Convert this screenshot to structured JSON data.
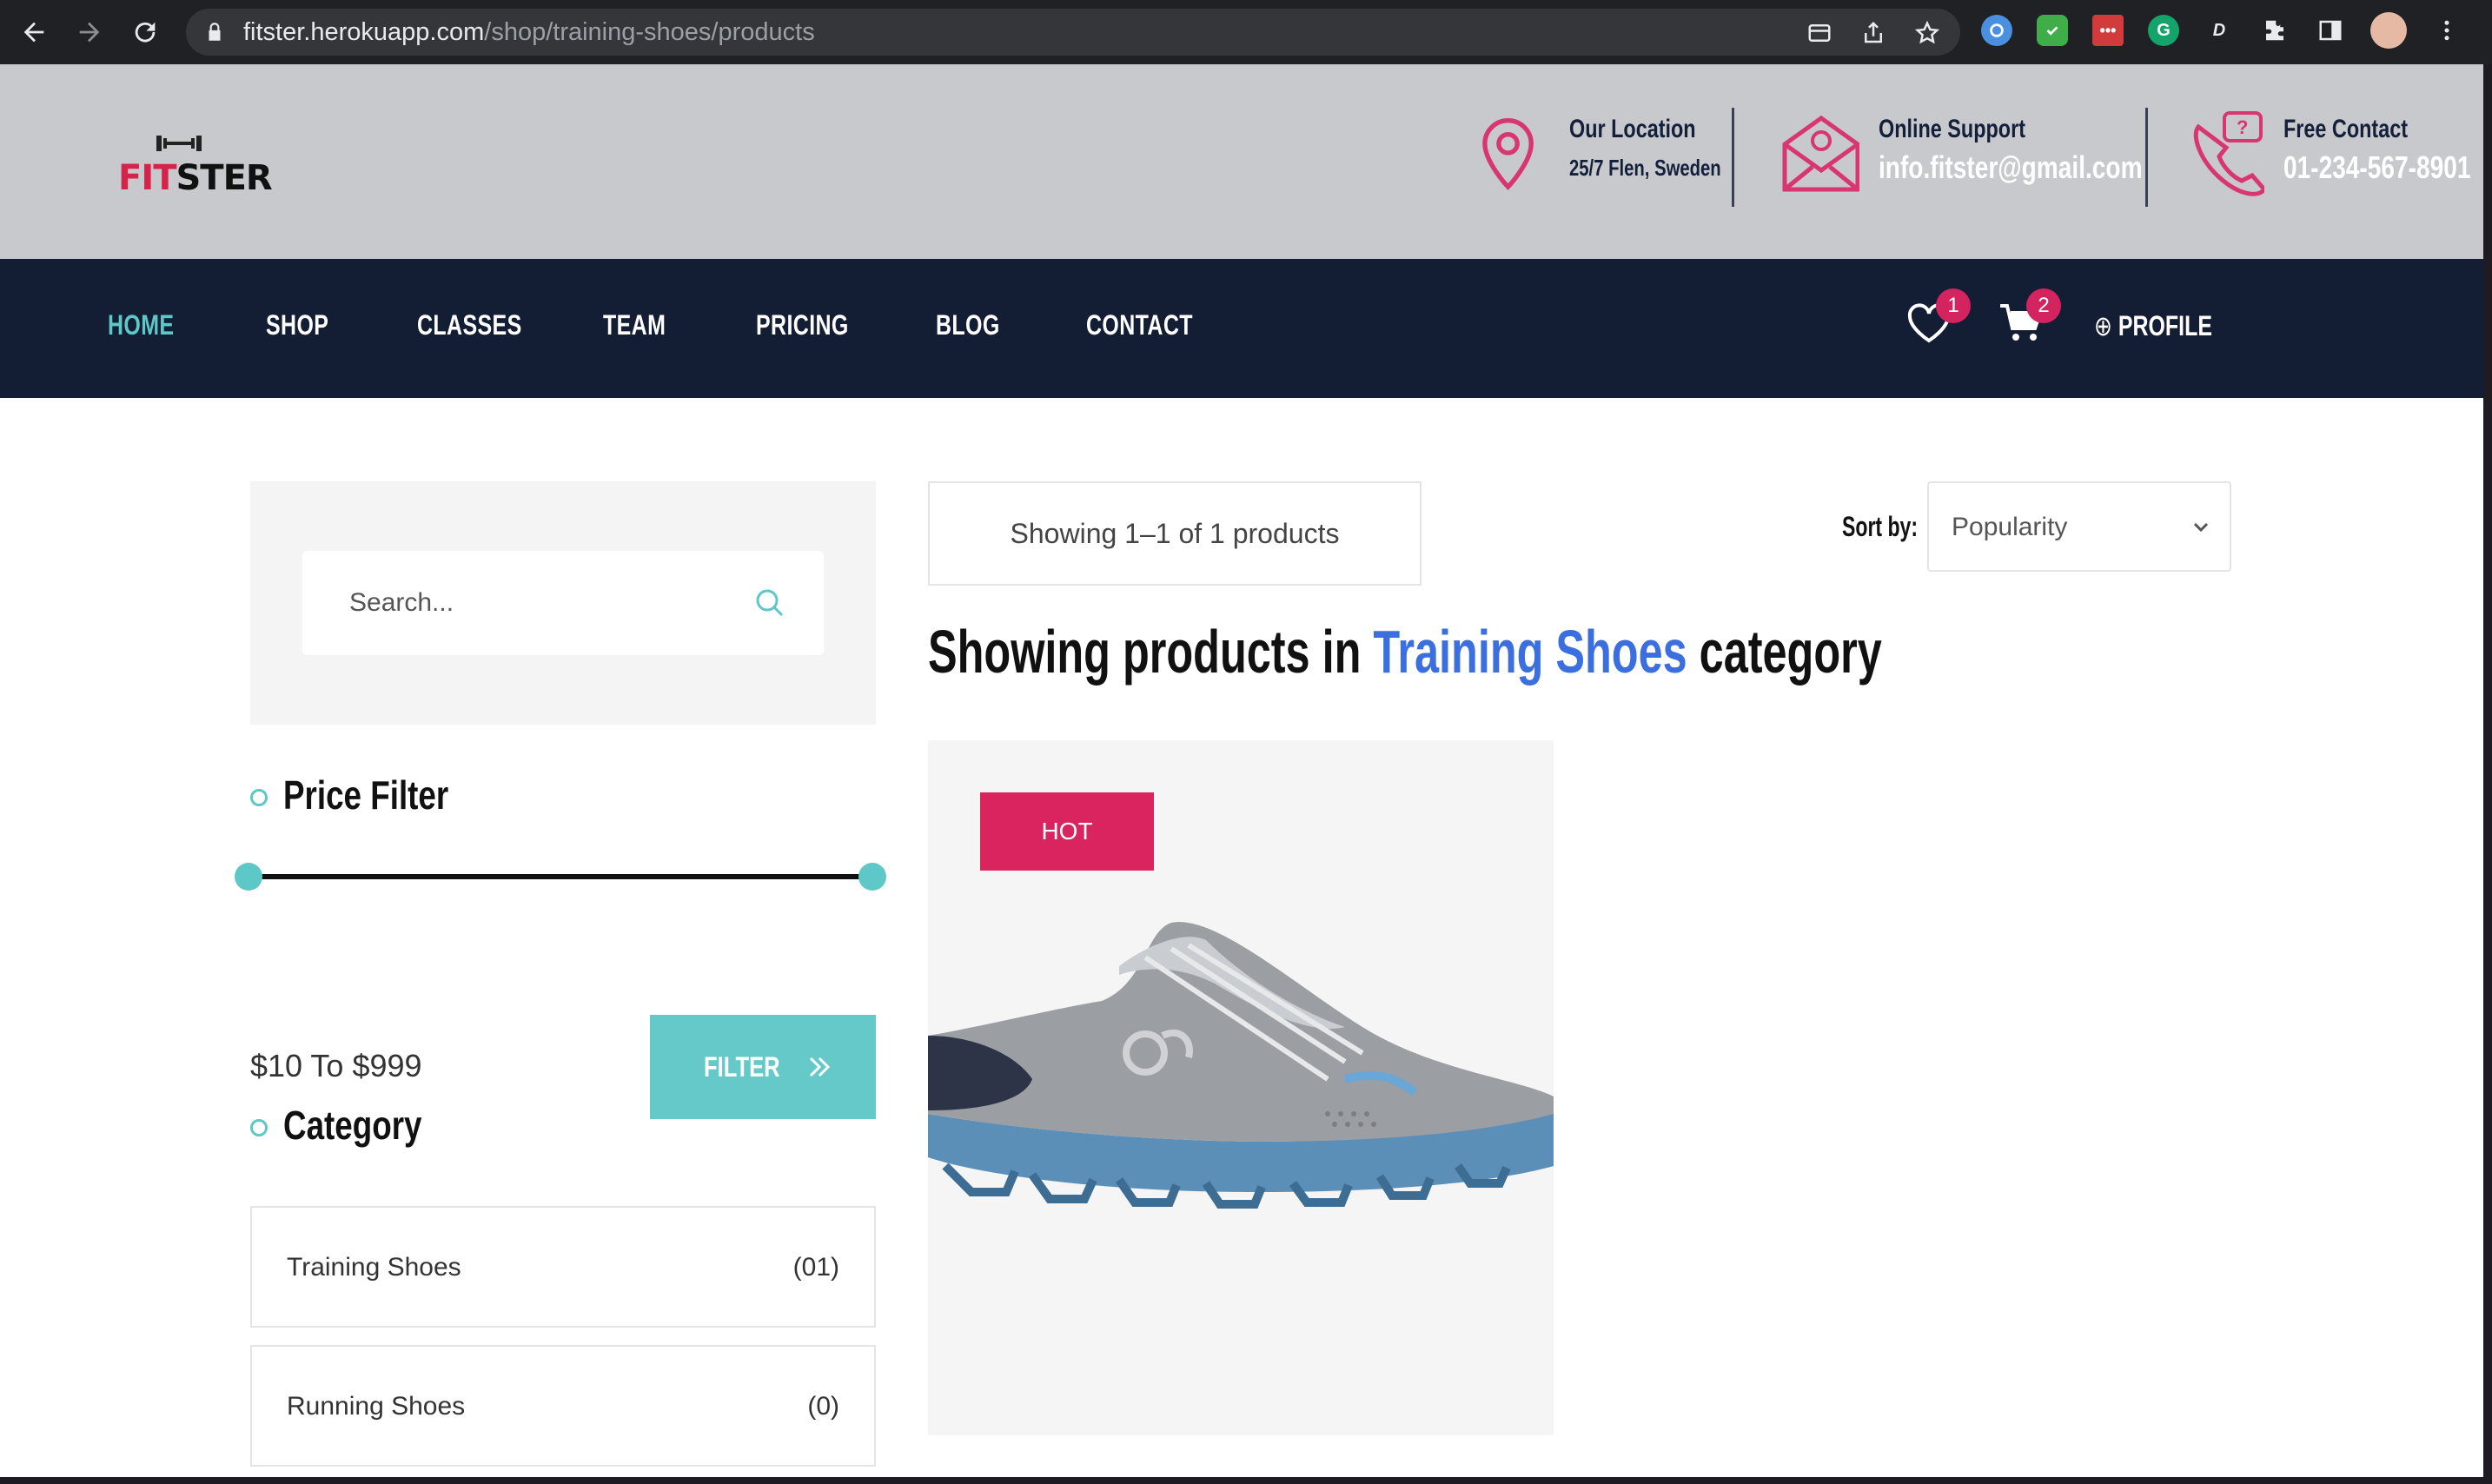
{
  "browser": {
    "url_host": "fitster.herokuapp.com",
    "url_path": "/shop/training-shoes/products"
  },
  "header": {
    "logo": {
      "prefix": "FIT",
      "suffix": "STER"
    },
    "location": {
      "title": "Our Location",
      "value": "25/7 Flen, Sweden",
      "icon": "map-pin-icon"
    },
    "support": {
      "title": "Online Support",
      "value": "info.fitster@gmail.com",
      "icon": "envelope-icon"
    },
    "contact": {
      "title": "Free Contact",
      "value": "01-234-567-8901",
      "icon": "phone-icon"
    }
  },
  "nav": {
    "items": [
      "HOME",
      "SHOP",
      "CLASSES",
      "TEAM",
      "PRICING",
      "BLOG",
      "CONTACT"
    ],
    "active": "HOME",
    "wishlist_count": "1",
    "cart_count": "2",
    "profile_label": "PROFILE"
  },
  "sidebar": {
    "search_placeholder": "Search...",
    "price_filter_title": "Price Filter",
    "price_range": "$10 To $999",
    "price_min_fraction": 0.0,
    "price_max_fraction": 1.0,
    "filter_label": "FILTER",
    "category_title": "Category",
    "categories": [
      {
        "name": "Training Shoes",
        "count": "(01)"
      },
      {
        "name": "Running Shoes",
        "count": "(0)"
      }
    ]
  },
  "content": {
    "result_count": "Showing 1–1 of 1 products",
    "sort_label": "Sort by:",
    "sort_value": "Popularity",
    "heading_prefix": "Showing products in",
    "heading_category": "Training Shoes",
    "heading_suffix": "category",
    "products": [
      {
        "badge": "HOT",
        "image": "grey-running-shoe"
      }
    ]
  },
  "colors": {
    "accent_teal": "#5ec8c8",
    "accent_pink": "#d9245f",
    "nav_bg": "#131d33",
    "topbar_bg": "#c8c9cd",
    "heading_link": "#3b6fe0"
  }
}
